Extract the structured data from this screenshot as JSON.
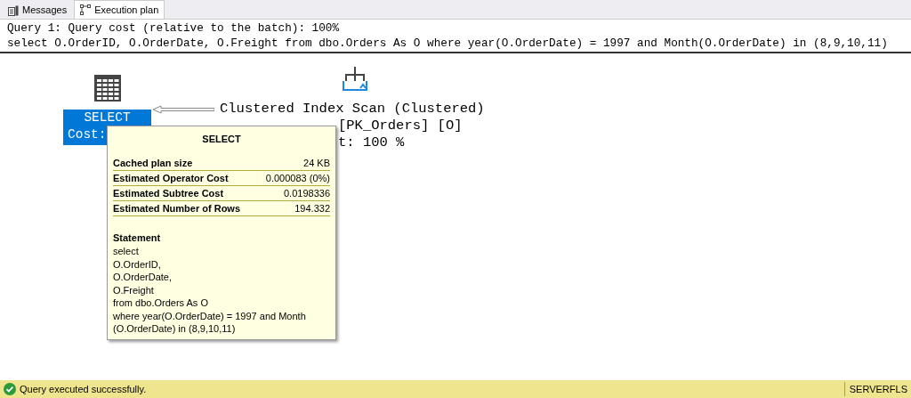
{
  "tabs": [
    {
      "label": "Messages",
      "kind": "messages",
      "selected": false
    },
    {
      "label": "Execution plan",
      "kind": "plan",
      "selected": true
    }
  ],
  "query_header": [
    "Query 1: Query cost (relative to the batch): 100%",
    "select O.OrderID, O.OrderDate, O.Freight from dbo.Orders As O where year(O.OrderDate) = 1997 and Month(O.OrderDate) in (8,9,10,11)"
  ],
  "select_node": {
    "lines": [
      "SELECT",
      "Cost:"
    ],
    "selected": true
  },
  "scan_node": {
    "lines": [
      "Clustered Index Scan (Clustered)",
      "[PK_Orders] [O]",
      "t: 100 %"
    ]
  },
  "tooltip": {
    "title": "SELECT",
    "properties": [
      {
        "name": "Cached plan size",
        "value": "24 KB"
      },
      {
        "name": "Estimated Operator Cost",
        "value": "0.000083 (0%)"
      },
      {
        "name": "Estimated Subtree Cost",
        "value": "0.0198336"
      },
      {
        "name": "Estimated Number of Rows",
        "value": "194.332"
      }
    ],
    "statement_label": "Statement",
    "statement": [
      "select",
      "O.OrderID,",
      "O.OrderDate,",
      "O.Freight",
      "from dbo.Orders As O",
      "where year(O.OrderDate) = 1997 and Month",
      "(O.OrderDate) in (8,9,10,11)"
    ]
  },
  "status_bar": {
    "message": "Query executed successfully.",
    "server": "SERVERFLS"
  }
}
